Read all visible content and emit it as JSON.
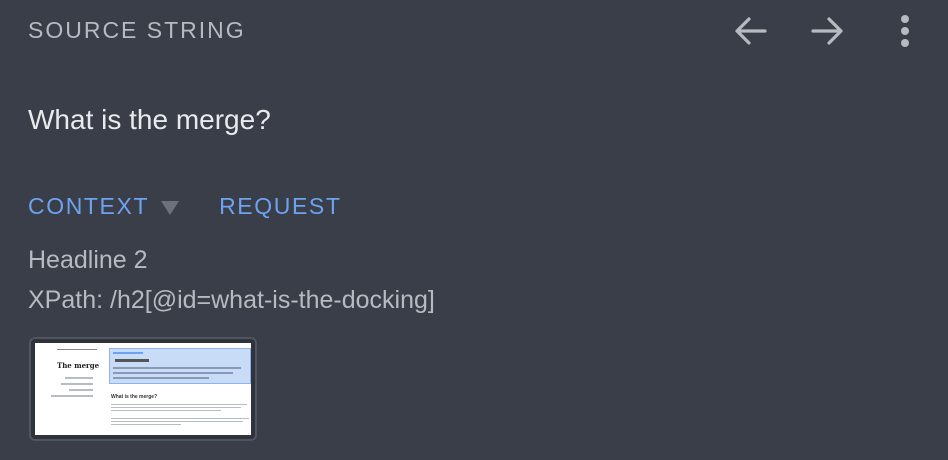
{
  "header": {
    "title": "SOURCE STRING",
    "back_icon": "arrow-left-icon",
    "forward_icon": "arrow-right-icon",
    "menu_icon": "more-vert-icon"
  },
  "source_string": {
    "text": "What is the merge?"
  },
  "tabs": [
    {
      "label": "CONTEXT",
      "has_dropdown": true
    },
    {
      "label": "REQUEST",
      "has_dropdown": false
    }
  ],
  "context": {
    "element_type": "Headline 2",
    "xpath": "XPath: /h2[@id=what-is-the-docking]"
  },
  "screenshot_thumbnail": {
    "page_title": "The merge",
    "section_heading": "What is the merge?"
  },
  "colors": {
    "background": "#393e48",
    "accent": "#6ea2f0",
    "muted_text": "#b7bac0",
    "primary_text": "#e9eaec"
  }
}
